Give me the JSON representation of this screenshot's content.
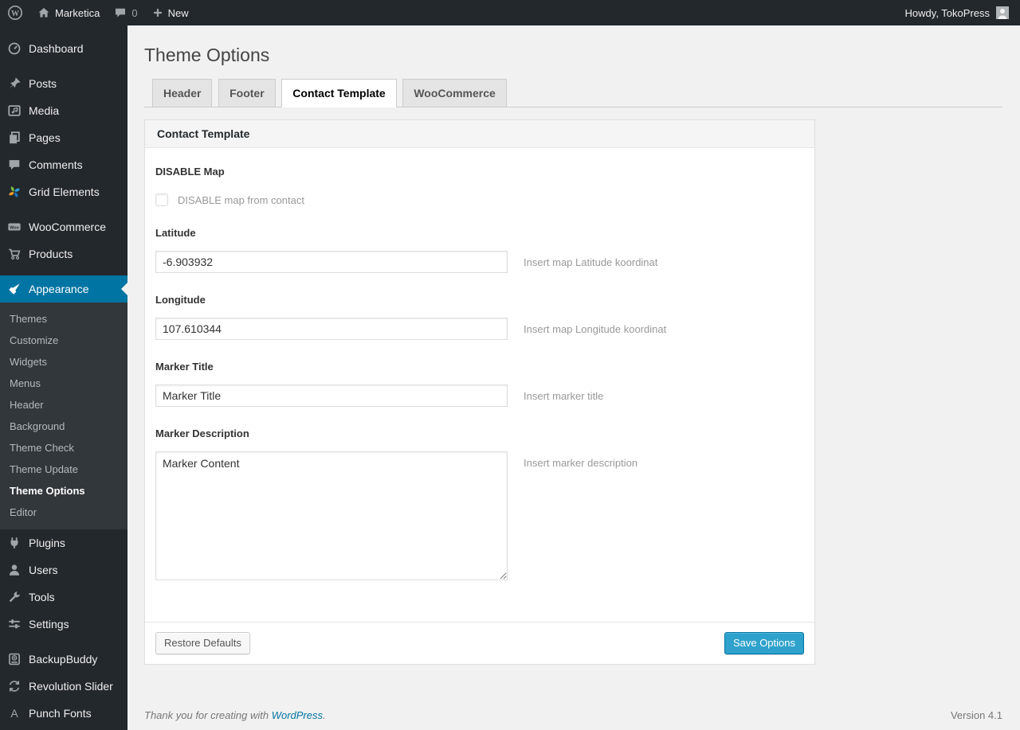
{
  "admin_bar": {
    "site_name": "Marketica",
    "comments_count": "0",
    "new_label": "New",
    "howdy": "Howdy, TokoPress"
  },
  "sidebar": {
    "items": [
      {
        "label": "Dashboard"
      },
      {
        "label": "Posts"
      },
      {
        "label": "Media"
      },
      {
        "label": "Pages"
      },
      {
        "label": "Comments"
      },
      {
        "label": "Grid Elements"
      },
      {
        "label": "WooCommerce"
      },
      {
        "label": "Products"
      },
      {
        "label": "Appearance"
      },
      {
        "label": "Plugins"
      },
      {
        "label": "Users"
      },
      {
        "label": "Tools"
      },
      {
        "label": "Settings"
      },
      {
        "label": "BackupBuddy"
      },
      {
        "label": "Revolution Slider"
      },
      {
        "label": "Punch Fonts"
      }
    ],
    "appearance_submenu": [
      {
        "label": "Themes",
        "current": false
      },
      {
        "label": "Customize",
        "current": false
      },
      {
        "label": "Widgets",
        "current": false
      },
      {
        "label": "Menus",
        "current": false
      },
      {
        "label": "Header",
        "current": false
      },
      {
        "label": "Background",
        "current": false
      },
      {
        "label": "Theme Check",
        "current": false
      },
      {
        "label": "Theme Update",
        "current": false
      },
      {
        "label": "Theme Options",
        "current": true
      },
      {
        "label": "Editor",
        "current": false
      }
    ]
  },
  "main": {
    "page_title": "Theme Options",
    "tabs": [
      {
        "label": "Header",
        "active": false
      },
      {
        "label": "Footer",
        "active": false
      },
      {
        "label": "Contact Template",
        "active": true
      },
      {
        "label": "WooCommerce",
        "active": false
      }
    ],
    "panel": {
      "title": "Contact Template",
      "disable_map": {
        "label": "DISABLE Map",
        "checkbox_label": "DISABLE map from contact",
        "checked": false
      },
      "latitude": {
        "label": "Latitude",
        "value": "-6.903932",
        "hint": "Insert map Latitude koordinat"
      },
      "longitude": {
        "label": "Longitude",
        "value": "107.610344",
        "hint": "Insert map Longitude koordinat"
      },
      "marker_title": {
        "label": "Marker Title",
        "value": "Marker Title",
        "hint": "Insert marker title"
      },
      "marker_description": {
        "label": "Marker Description",
        "value": "Marker Content",
        "hint": "Insert marker description"
      },
      "restore_label": "Restore Defaults",
      "save_label": "Save Options"
    }
  },
  "footer": {
    "thanks_prefix": "Thank you for creating with ",
    "link_label": "WordPress",
    "thanks_suffix": ".",
    "version": "Version 4.1"
  },
  "colors": {
    "admin_bar_bg": "#23282d",
    "sidebar_bg": "#23282d",
    "submenu_bg": "#32373c",
    "active_menu": "#0074a2",
    "primary_button": "#2ea2cc",
    "content_bg": "#f1f1f1",
    "link": "#0074a2"
  }
}
